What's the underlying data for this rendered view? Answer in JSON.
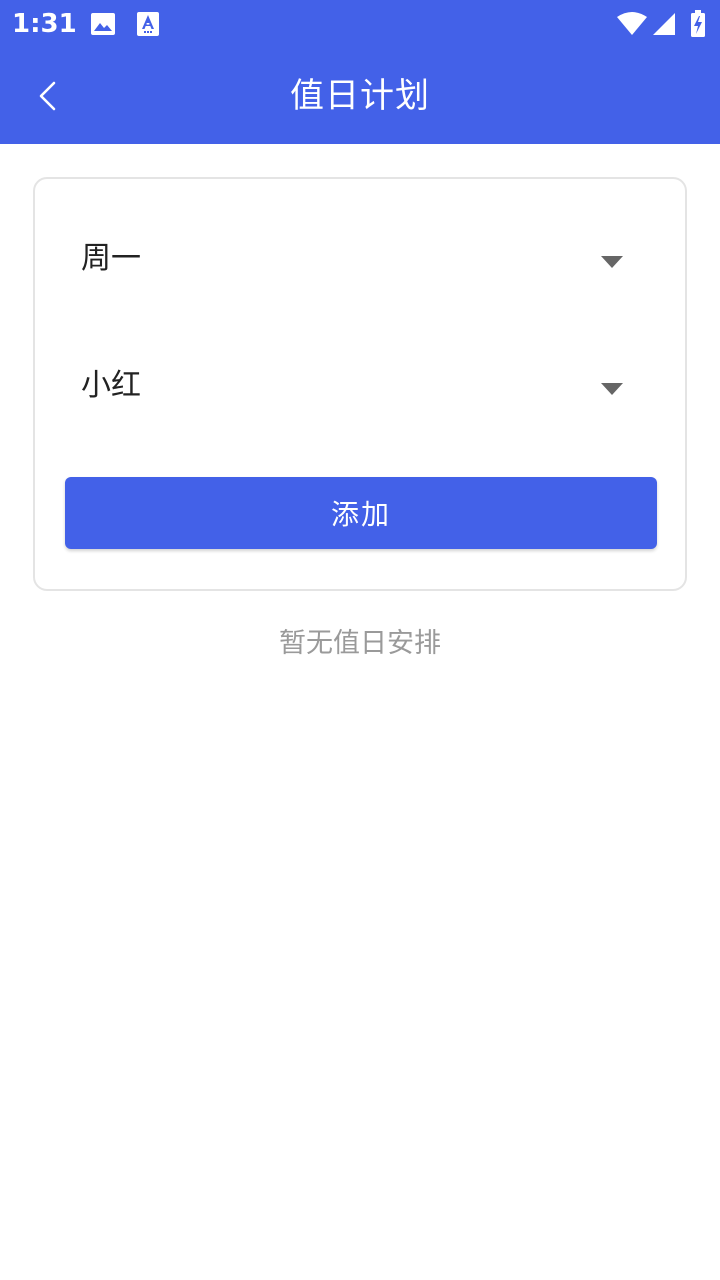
{
  "status_bar": {
    "time": "1:31",
    "left_icons": [
      "image-icon",
      "font-download-icon"
    ],
    "right_icons": [
      "wifi-icon",
      "cellular-signal-icon",
      "battery-charging-icon"
    ]
  },
  "app_bar": {
    "title": "值日计划",
    "back_icon": "chevron-left-icon",
    "background_color": "#4361e8"
  },
  "form": {
    "day_select": {
      "value": "周一"
    },
    "person_select": {
      "value": "小红"
    },
    "add_button_label": "添加"
  },
  "empty_state": {
    "message": "暂无值日安排"
  },
  "colors": {
    "accent": "#4361e8",
    "muted_text": "#9a9a9a",
    "card_border": "#e4e4e4"
  }
}
